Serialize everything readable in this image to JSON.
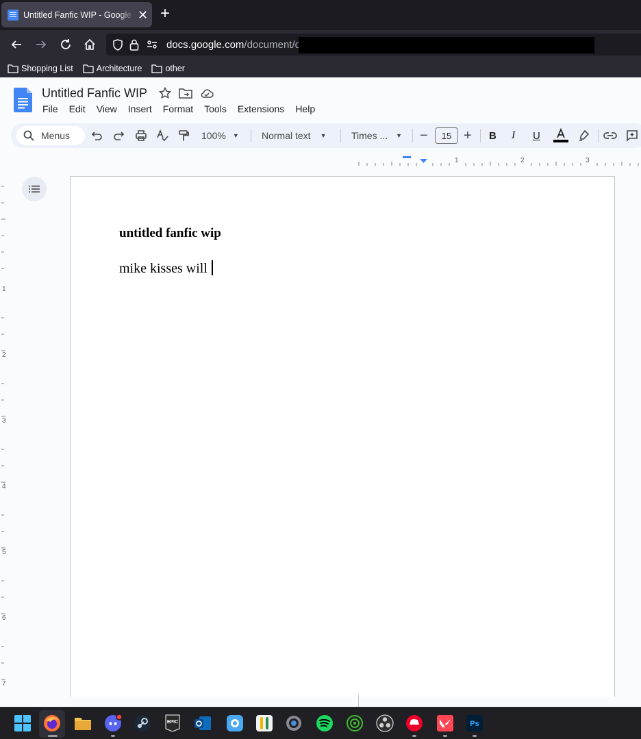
{
  "browser": {
    "tab_title": "Untitled Fanfic WIP - Google Docs",
    "url_domain": "docs.google.com",
    "url_path": "/document/d/",
    "bookmarks": [
      {
        "label": "Shopping List"
      },
      {
        "label": "Architecture"
      },
      {
        "label": "other"
      }
    ]
  },
  "docs": {
    "title": "Untitled Fanfic WIP",
    "menu": [
      "File",
      "Edit",
      "View",
      "Insert",
      "Format",
      "Tools",
      "Extensions",
      "Help"
    ],
    "toolbar": {
      "search_label": "Menus",
      "zoom": "100%",
      "style": "Normal text",
      "font": "Times ...",
      "font_size": "15"
    },
    "ruler_numbers": [
      "1",
      "2",
      "3"
    ],
    "vruler_numbers": [
      "1",
      "2",
      "3",
      "4",
      "5",
      "6",
      "7"
    ],
    "content": {
      "heading": "untitled fanfic wip",
      "body": "mike kisses will"
    }
  },
  "colors": {
    "docs_blue": "#4285f4",
    "browser_bg": "#1c1b22",
    "toolbar_bg": "#edf2fa"
  },
  "taskbar_icons": [
    "windows-start-icon",
    "firefox-icon",
    "file-explorer-icon",
    "discord-icon",
    "steam-icon",
    "epic-games-icon",
    "outlook-icon",
    "photos-icon",
    "password-manager-icon",
    "settings-icon",
    "spotify-icon",
    "xbox-icon",
    "obs-icon",
    "riot-client-icon",
    "valorant-icon",
    "photoshop-icon"
  ]
}
